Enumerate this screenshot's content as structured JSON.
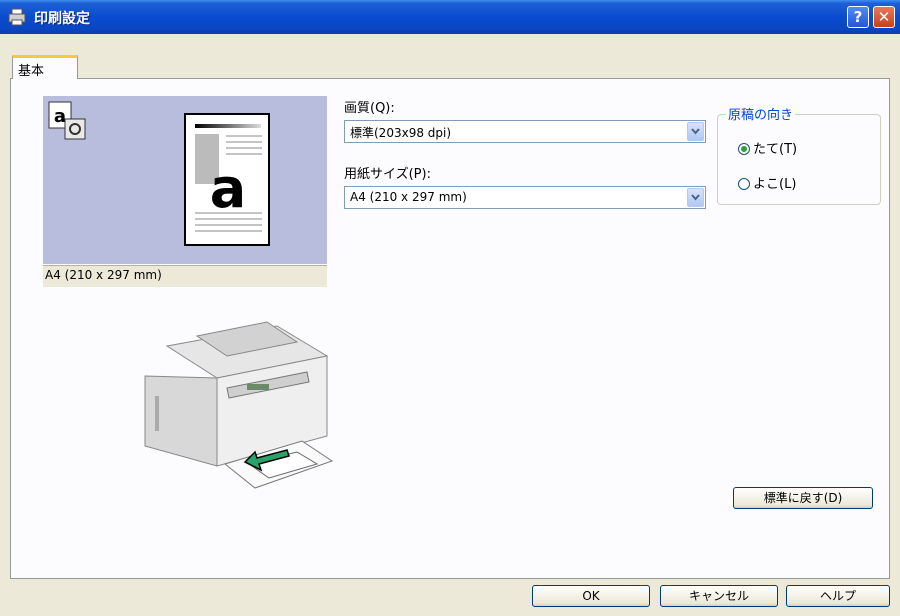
{
  "window": {
    "title": "印刷設定",
    "help_glyph": "?",
    "close_glyph": "✕"
  },
  "tabs": [
    {
      "label": "基本"
    }
  ],
  "preview": {
    "paper_letter": "a",
    "icon_letter": "a",
    "caption": "A4 (210 x 297 mm)"
  },
  "quality": {
    "label": "画質(Q):",
    "value": "標準(203x98 dpi)"
  },
  "paper_size": {
    "label": "用紙サイズ(P):",
    "value": "A4 (210 x 297 mm)"
  },
  "orientation": {
    "legend": "原稿の向き",
    "options": [
      {
        "label": "たて(T)",
        "selected": true
      },
      {
        "label": "よこ(L)",
        "selected": false
      }
    ]
  },
  "buttons": {
    "restore_default": "標準に戻す(D)",
    "ok": "OK",
    "cancel": "キャンセル",
    "help": "ヘルプ"
  },
  "colors": {
    "titlebar": "#0a4ccf",
    "accent_tab": "#ffc83c",
    "group_label": "#0046d5",
    "preview_bg": "#b8bcdd"
  }
}
